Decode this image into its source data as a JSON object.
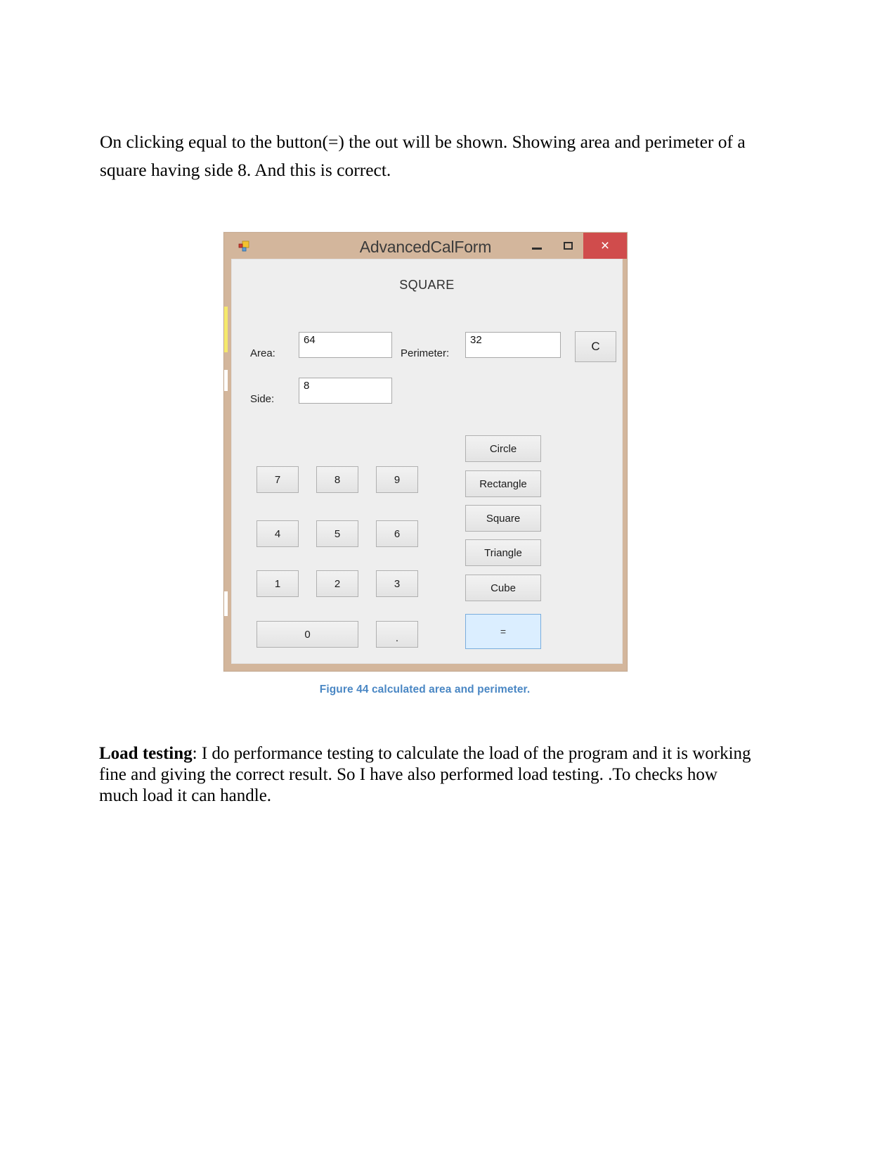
{
  "document": {
    "intro_paragraph": "On clicking equal to the button(=) the out will be shown. Showing area and perimeter of a square having side 8. And this is correct.",
    "figure_caption": "Figure 44 calculated area and perimeter.",
    "load_testing_label": "Load testing",
    "load_testing_body": ": I do performance testing to calculate the load of the program and it is working fine and giving the correct result. So I have also performed load testing. .To checks how much load it can handle.",
    "caption_color": "#4a87c4"
  },
  "window": {
    "title": "AdvancedCalForm",
    "titlebar_color": "#d3b69c",
    "close_color": "#d04c4c",
    "icon": "form-designer-icon",
    "buttons": {
      "minimize": "minimize-icon",
      "maximize": "maximize-icon",
      "close": "×"
    }
  },
  "form": {
    "heading": "SQUARE",
    "fields": [
      {
        "label": "Area:",
        "value": "64"
      },
      {
        "label": "Perimeter:",
        "value": "32"
      },
      {
        "label": "Side:",
        "value": "8"
      }
    ],
    "clear_button": "C",
    "keypad": [
      {
        "label": "7"
      },
      {
        "label": "8"
      },
      {
        "label": "9"
      },
      {
        "label": "4"
      },
      {
        "label": "5"
      },
      {
        "label": "6"
      },
      {
        "label": "1"
      },
      {
        "label": "2"
      },
      {
        "label": "3"
      },
      {
        "label": "0"
      },
      {
        "label": "."
      }
    ],
    "shape_buttons": [
      {
        "label": "Circle"
      },
      {
        "label": "Rectangle"
      },
      {
        "label": "Square"
      },
      {
        "label": "Triangle"
      },
      {
        "label": "Cube"
      }
    ],
    "equals_button": "=",
    "equals_highlight_color": "#dbeeff",
    "equals_border_color": "#7aaddd"
  }
}
